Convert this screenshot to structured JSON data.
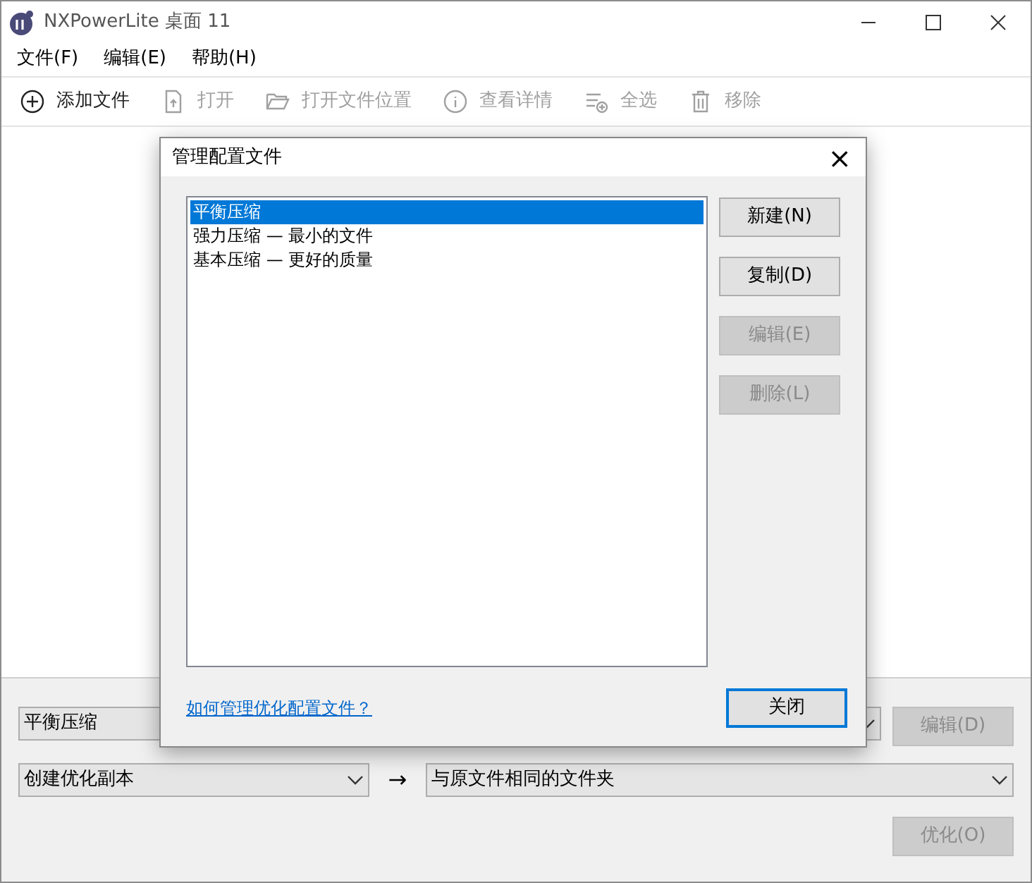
{
  "window": {
    "title": "NXPowerLite 桌面 11"
  },
  "menu": [
    "文件(F)",
    "编辑(E)",
    "帮助(H)"
  ],
  "toolbar": [
    {
      "label": "添加文件",
      "kind": "add",
      "disabled": false
    },
    {
      "label": "打开",
      "kind": "file",
      "disabled": true
    },
    {
      "label": "打开文件位置",
      "kind": "folder",
      "disabled": true
    },
    {
      "label": "查看详情",
      "kind": "info",
      "disabled": true
    },
    {
      "label": "全选",
      "kind": "select",
      "disabled": true
    },
    {
      "label": "移除",
      "kind": "trash",
      "disabled": true
    }
  ],
  "bottom": {
    "profile": "平衡压缩",
    "edit_button": {
      "label": "编辑(D)",
      "disabled": true
    },
    "action": "创建优化副本",
    "arrow": "→",
    "destination": "与原文件相同的文件夹",
    "optimize_button": {
      "label": "优化(O)",
      "disabled": true
    }
  },
  "dialog": {
    "title": "管理配置文件",
    "close": "×",
    "profiles": [
      {
        "label": "平衡压缩",
        "selected": true
      },
      {
        "label": "强力压缩 — 最小的文件",
        "selected": false
      },
      {
        "label": "基本压缩 — 更好的质量",
        "selected": false
      }
    ],
    "buttons": [
      {
        "label": "新建(N)",
        "disabled": false
      },
      {
        "label": "复制(D)",
        "disabled": false
      },
      {
        "label": "编辑(E)",
        "disabled": true
      },
      {
        "label": "删除(L)",
        "disabled": true
      }
    ],
    "help_link": "如何管理优化配置文件？",
    "close_button": "关闭"
  }
}
